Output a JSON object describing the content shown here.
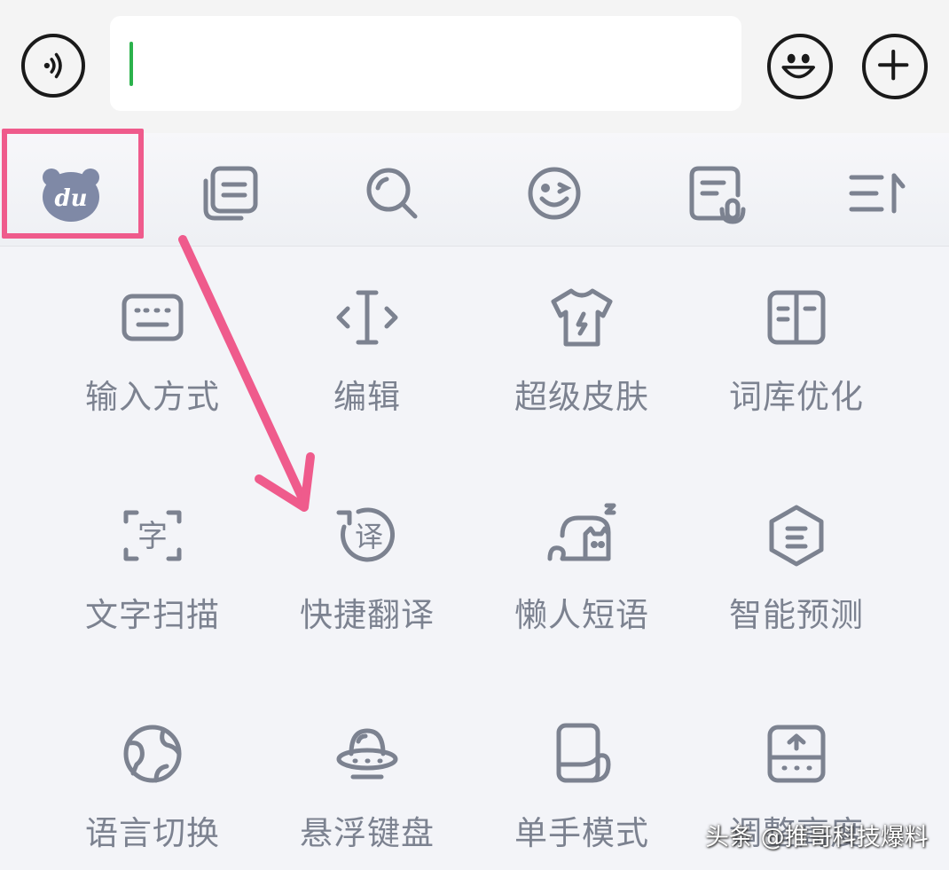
{
  "input_bar": {
    "voice_icon": "voice-wave-icon",
    "emoji_icon": "smile-face-icon",
    "plus_icon": "plus-icon",
    "caret_color": "#2bb24c"
  },
  "toolbar": {
    "items": [
      {
        "name": "du-logo-icon"
      },
      {
        "name": "clipboard-icon"
      },
      {
        "name": "search-icon"
      },
      {
        "name": "emoji-wink-icon"
      },
      {
        "name": "note-voice-icon"
      },
      {
        "name": "collapse-menu-icon"
      }
    ],
    "logo_text": "du",
    "highlight_color": "#ef5b8c"
  },
  "grid": {
    "items": [
      {
        "label": "输入方式",
        "icon": "keyboard-icon"
      },
      {
        "label": "编辑",
        "icon": "text-cursor-icon"
      },
      {
        "label": "超级皮肤",
        "icon": "tshirt-icon"
      },
      {
        "label": "词库优化",
        "icon": "book-icon"
      },
      {
        "label": "文字扫描",
        "icon": "scan-text-icon"
      },
      {
        "label": "快捷翻译",
        "icon": "translate-icon"
      },
      {
        "label": "懒人短语",
        "icon": "lazy-cat-icon"
      },
      {
        "label": "智能预测",
        "icon": "hexagon-predict-icon"
      },
      {
        "label": "语言切换",
        "icon": "globe-icon"
      },
      {
        "label": "悬浮键盘",
        "icon": "ufo-icon"
      },
      {
        "label": "单手模式",
        "icon": "one-hand-icon"
      },
      {
        "label": "调整高度",
        "icon": "adjust-height-icon"
      }
    ]
  },
  "watermark": "头条 @推哥科技爆料",
  "colors": {
    "icon_gray": "#7c8290",
    "arrow": "#ef5b8c"
  }
}
